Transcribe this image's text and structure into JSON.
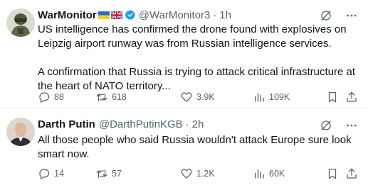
{
  "colors": {
    "text": "#0f1419",
    "muted": "#536471",
    "verified": "#1d9bf0",
    "divider": "#e6ecf0"
  },
  "tweets": [
    {
      "display_name": "WarMonitor",
      "flags": [
        "ukraine-flag",
        "uk-flag"
      ],
      "verified": true,
      "handle": "@WarMonitor3",
      "separator": "·",
      "time": "1h",
      "paragraphs": [
        "US intelligence has confirmed the drone found with explosives on Leipzig airport runway was from Russian intelligence services.",
        "A confirmation that Russia is trying to attack critical infrastructure at the heart of NATO territory..."
      ],
      "replies": "88",
      "reposts": "618",
      "likes": "3.9K",
      "views": "109K"
    },
    {
      "display_name": "Darth Putin",
      "verified": false,
      "handle": "@DarthPutinKGB",
      "separator": "·",
      "time": "2h",
      "paragraphs": [
        "All those people who said Russia wouldn't attack Europe  sure look smart now."
      ],
      "replies": "14",
      "reposts": "57",
      "likes": "1.2K",
      "views": "60K"
    }
  ]
}
